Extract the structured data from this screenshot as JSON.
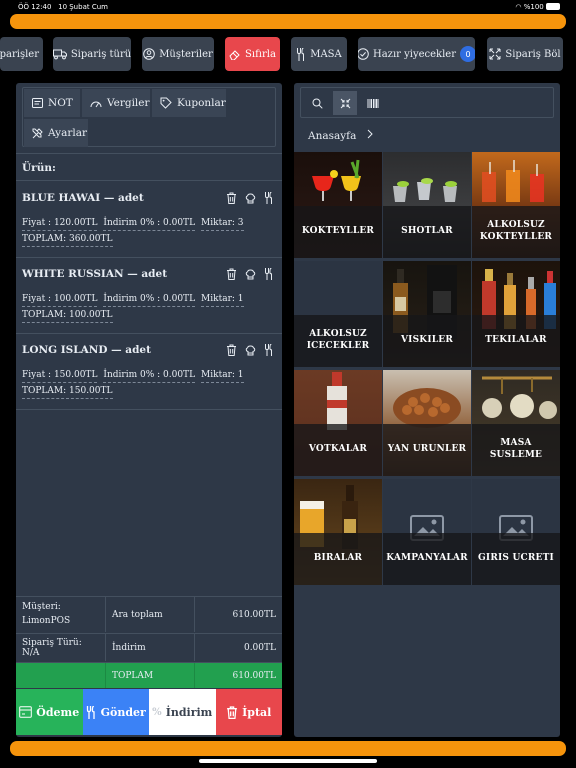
{
  "status": {
    "time": "ÖÖ 12:40",
    "date": "10 Şubat Cum",
    "battery": "%100"
  },
  "toolbar": {
    "orders": "Siparişler",
    "order_type": "Sipariş türü",
    "customers": "Müşteriler",
    "reset": "Sıfırla",
    "table": "MASA",
    "ready_food": "Hazır yiyecekler",
    "ready_count": "0",
    "split": "Sipariş Böl"
  },
  "tabs": {
    "note": "NOT",
    "taxes": "Vergiler",
    "coupons": "Kuponlar",
    "settings": "Ayarlar"
  },
  "order": {
    "title": "Ürün:",
    "items": [
      {
        "name": "BLUE HAWAI — adet",
        "price": "Fiyat : 120.00TL",
        "discount": "İndirim 0% : 0.00TL",
        "qty": "Miktar: 3",
        "total": "TOPLAM: 360.00TL"
      },
      {
        "name": "WHITE RUSSIAN — adet",
        "price": "Fiyat : 100.00TL",
        "discount": "İndirim 0% : 0.00TL",
        "qty": "Miktar: 1",
        "total": "TOPLAM: 100.00TL"
      },
      {
        "name": "LONG ISLAND — adet",
        "price": "Fiyat : 150.00TL",
        "discount": "İndirim 0% : 0.00TL",
        "qty": "Miktar: 1",
        "total": "TOPLAM: 150.00TL"
      }
    ]
  },
  "summary": {
    "customer": "Müşteri: LimonPOS",
    "order_type": "Sipariş Türü: N/A",
    "subtotal_label": "Ara toplam",
    "subtotal": "610.00TL",
    "discount_label": "İndirim",
    "discount": "0.00TL",
    "total_label": "TOPLAM",
    "total": "610.00TL"
  },
  "actions": {
    "pay": "Ödeme",
    "send": "Gönder",
    "discount": "İndirim",
    "cancel": "İptal"
  },
  "colors": {
    "accent": "#f6940c",
    "pay": "#27b35a",
    "send": "#3b82f6",
    "cancel": "#e8474c",
    "panel": "#2e3847"
  },
  "catalog": {
    "breadcrumb": "Anasayfa",
    "categories": [
      {
        "label": "KOKTEYLLER"
      },
      {
        "label": "SHOTLAR"
      },
      {
        "label": "ALKOLSUZ KOKTEYLLER"
      },
      {
        "label": "ALKOLSUZ ICECEKLER"
      },
      {
        "label": "VISKILER"
      },
      {
        "label": "TEKILALAR"
      },
      {
        "label": "VOTKALAR"
      },
      {
        "label": "YAN URUNLER"
      },
      {
        "label": "MASA SUSLEME"
      },
      {
        "label": "BIRALAR"
      },
      {
        "label": "KAMPANYALAR"
      },
      {
        "label": "GIRIS UCRETI"
      }
    ]
  }
}
